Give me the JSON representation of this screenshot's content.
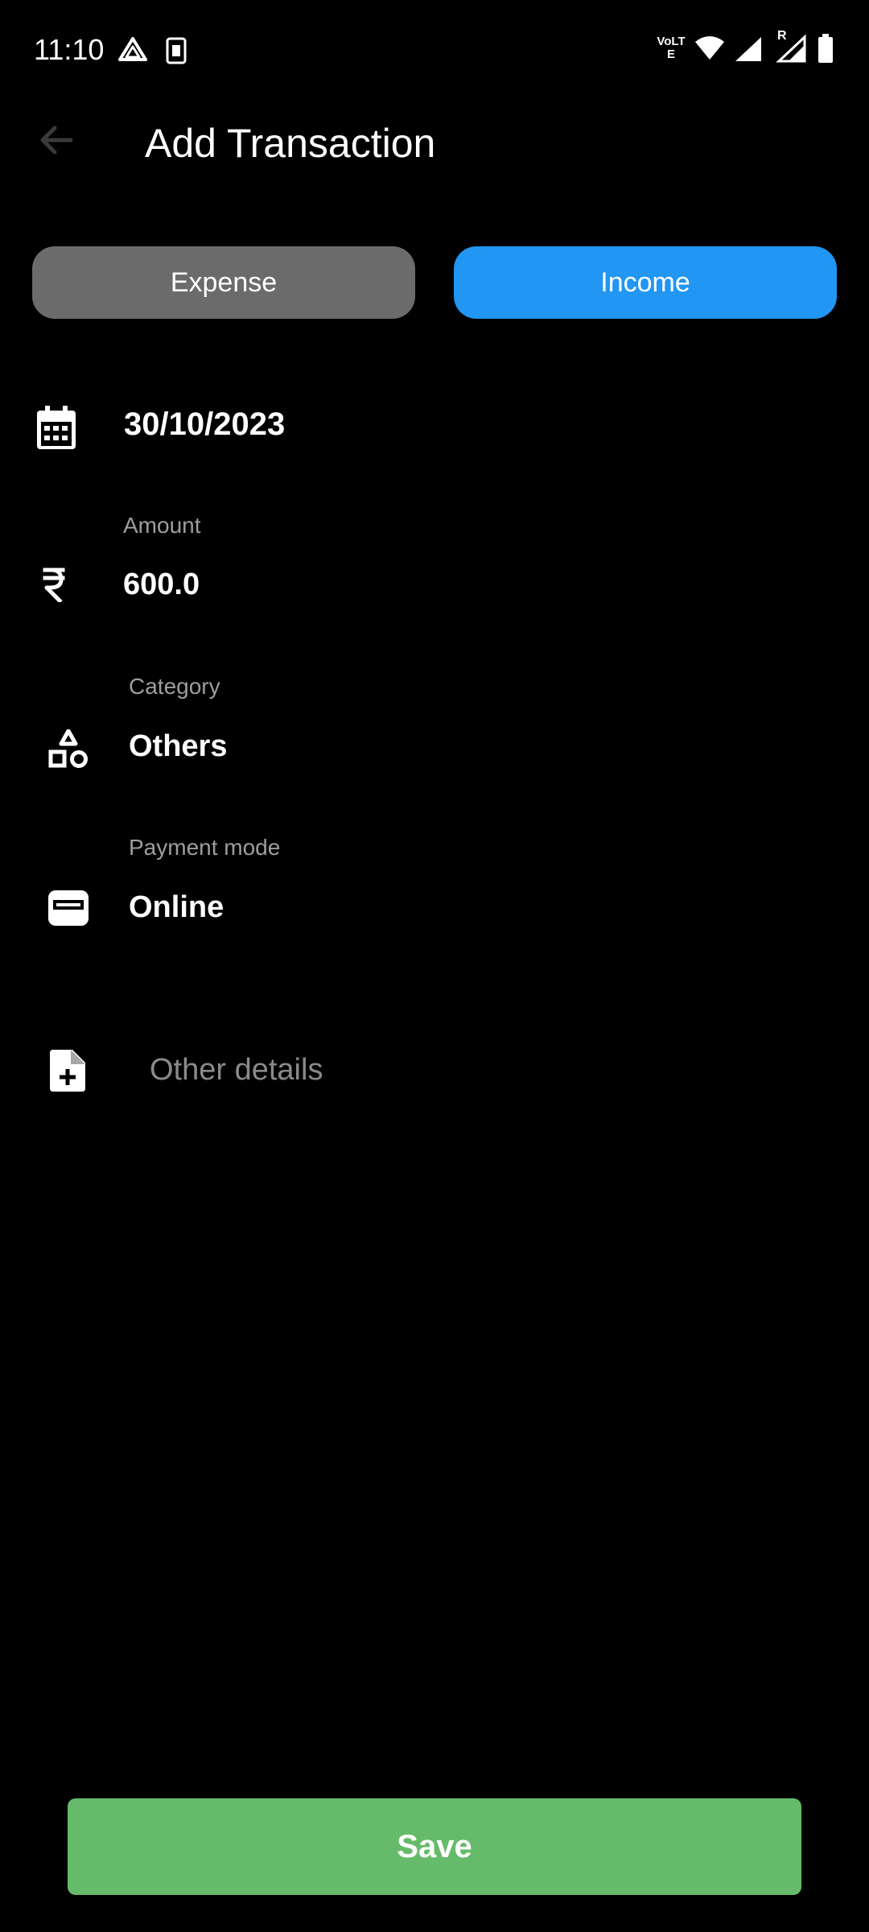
{
  "status_bar": {
    "time": "11:10",
    "network_label": "VoLTE",
    "icons": [
      "drive-icon",
      "sim-icon",
      "volte-icon",
      "wifi-icon",
      "signal-icon",
      "roaming-signal-icon",
      "battery-icon"
    ],
    "roaming_letter": "R"
  },
  "app_bar": {
    "title": "Add Transaction",
    "back_icon": "back-arrow-icon"
  },
  "type_toggle": {
    "expense_label": "Expense",
    "income_label": "Income",
    "selected": "Income"
  },
  "form": {
    "date": {
      "icon": "calendar-icon",
      "value": "30/10/2023"
    },
    "amount": {
      "icon": "rupee-icon",
      "label": "Amount",
      "value": "600.0"
    },
    "category": {
      "icon": "shapes-icon",
      "label": "Category",
      "value": "Others"
    },
    "payment_mode": {
      "icon": "wallet-icon",
      "label": "Payment mode",
      "value": "Online"
    },
    "other_details": {
      "icon": "note-add-icon",
      "placeholder": "Other details"
    }
  },
  "save_label": "Save",
  "colors": {
    "background": "#000000",
    "expense_button": "#6b6b6b",
    "income_button": "#2196f3",
    "save_button": "#66bb6a",
    "label_text": "#9e9e9e",
    "placeholder_text": "#8a8a8a"
  }
}
